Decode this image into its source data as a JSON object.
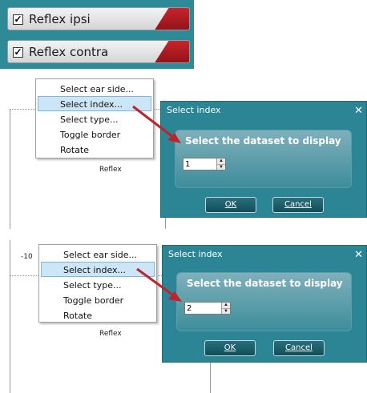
{
  "toggles": [
    {
      "label": "Reflex ipsi",
      "checked": true
    },
    {
      "label": "Reflex contra",
      "checked": true
    }
  ],
  "scenes": [
    {
      "menu_items": [
        "Select ear side...",
        "Select index...",
        "Select type...",
        "Toggle border",
        "Rotate"
      ],
      "selected_index": 1,
      "graph_label": "Reflex",
      "axis_tick": "",
      "dialog": {
        "title": "Select index",
        "heading": "Select the dataset to display",
        "value": "1",
        "ok_label": "OK",
        "cancel_label": "Cancel"
      }
    },
    {
      "menu_items": [
        "Select ear side...",
        "Select index...",
        "Select type...",
        "Toggle border",
        "Rotate"
      ],
      "selected_index": 1,
      "graph_label": "Reflex",
      "axis_tick": "-10",
      "dialog": {
        "title": "Select index",
        "heading": "Select the dataset to display",
        "value": "2",
        "ok_label": "OK",
        "cancel_label": "Cancel"
      }
    }
  ],
  "colors": {
    "teal_panel": "#2f8a98",
    "dialog_bg": "#2b8595",
    "arrow_red": "#c0232b",
    "menu_highlight": "#cde6f7"
  },
  "icons": {
    "checkbox": "check-mark",
    "close": "close-icon",
    "spin_up": "triangle-up",
    "spin_down": "triangle-down"
  }
}
